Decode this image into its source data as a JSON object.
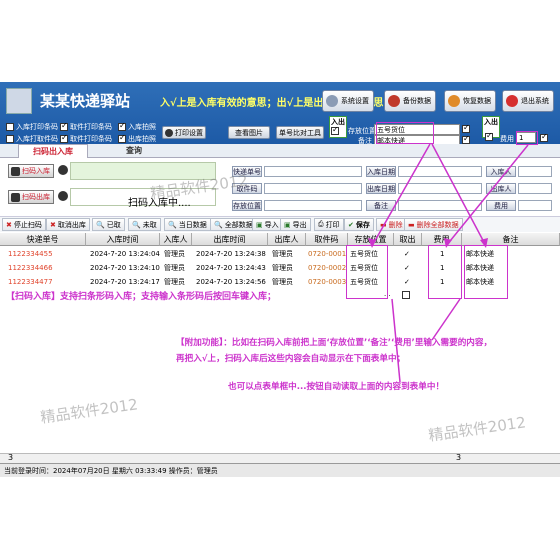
{
  "app": {
    "title": "某某快递驿站",
    "notice": "入√上是入库有效的意思；出√上是出库有效的意思；"
  },
  "options": [
    {
      "label": "入库打印条码",
      "checked": false
    },
    {
      "label": "取件打印条码",
      "checked": true
    },
    {
      "label": "入库拍照",
      "checked": true
    },
    {
      "label": "入库打取件码",
      "checked": false
    },
    {
      "label": "取件打印条码",
      "checked": true
    },
    {
      "label": "出库拍照",
      "checked": true
    }
  ],
  "buttons": {
    "print_settings": "打印设置",
    "view_photo": "查看图片",
    "single_number_tool": "单号比对工具",
    "system_settings": "系统设置",
    "backup_data": "备份数据",
    "restore_data": "恢复数据",
    "exit_system": "退出系统"
  },
  "header_fields": {
    "in_label": "入出",
    "storage_label": "存放位置",
    "storage_value": "五号货位",
    "note_label": "备注",
    "note_value": "邮本快递",
    "fee_label": "费用",
    "fee_value": "1"
  },
  "tabs": {
    "scan": "扫码出入库",
    "query": "查询"
  },
  "scan": {
    "in_button": "扫码入库",
    "out_button": "扫码出库",
    "status_text": "扫码入库中...."
  },
  "query_buttons": [
    "快递单号",
    "入库日期",
    "入库人",
    "取件码",
    "出库日期",
    "出库人",
    "存放位置",
    "备注",
    "费用"
  ],
  "toolbar": [
    "停止扫码",
    "取消出库",
    "已取",
    "未取",
    "当日数据",
    "全部数据",
    "导入",
    "导出",
    "打印",
    "保存",
    "删除",
    "删除全部数据"
  ],
  "columns": [
    "快递单号",
    "入库时间",
    "入库人",
    "出库时间",
    "出库人",
    "取件码",
    "存放位置",
    "取出",
    "费用",
    "备注"
  ],
  "rows": [
    [
      "1122334455",
      "2024-7-20 13:24:04",
      "管理员",
      "2024-7-20 13:24:38",
      "管理员",
      "0720-0001",
      "五号货位",
      "✓",
      "1",
      "邮本快递"
    ],
    [
      "1122334466",
      "2024-7-20 13:24:10",
      "管理员",
      "2024-7-20 13:24:43",
      "管理员",
      "0720-0002",
      "五号货位",
      "✓",
      "1",
      "邮本快递"
    ],
    [
      "1122334477",
      "2024-7-20 13:24:17",
      "管理员",
      "2024-7-20 13:24:56",
      "管理员",
      "0720-0003",
      "五号货位",
      "✓",
      "1",
      "邮本快递"
    ]
  ],
  "annotations": {
    "scan_note": "【扫码入库】支持扫条形码入库；支持输入条形码后按回车键入库；",
    "extra_line1": "【附加功能】：比如在扫码入库前把上面‘存放位置’‘备注’‘费用’里输入需要的内容，",
    "extra_line2": "再把入√上，扫码入库后这些内容会自动显示在下面表单中；",
    "extra_line3": "也可以点表单框中...按钮自动读取上面的内容到表单中！"
  },
  "watermark": "精品软件2012",
  "footer": {
    "left_count": "3",
    "right_count": "3",
    "status": "当前登录时间：2024年07月20日  星期六   03:33:49    操作员：管理员"
  },
  "colors": {
    "header_blue": "#1d5aa6",
    "annotation_magenta": "#cc33cc",
    "number_red": "#e0442c"
  }
}
